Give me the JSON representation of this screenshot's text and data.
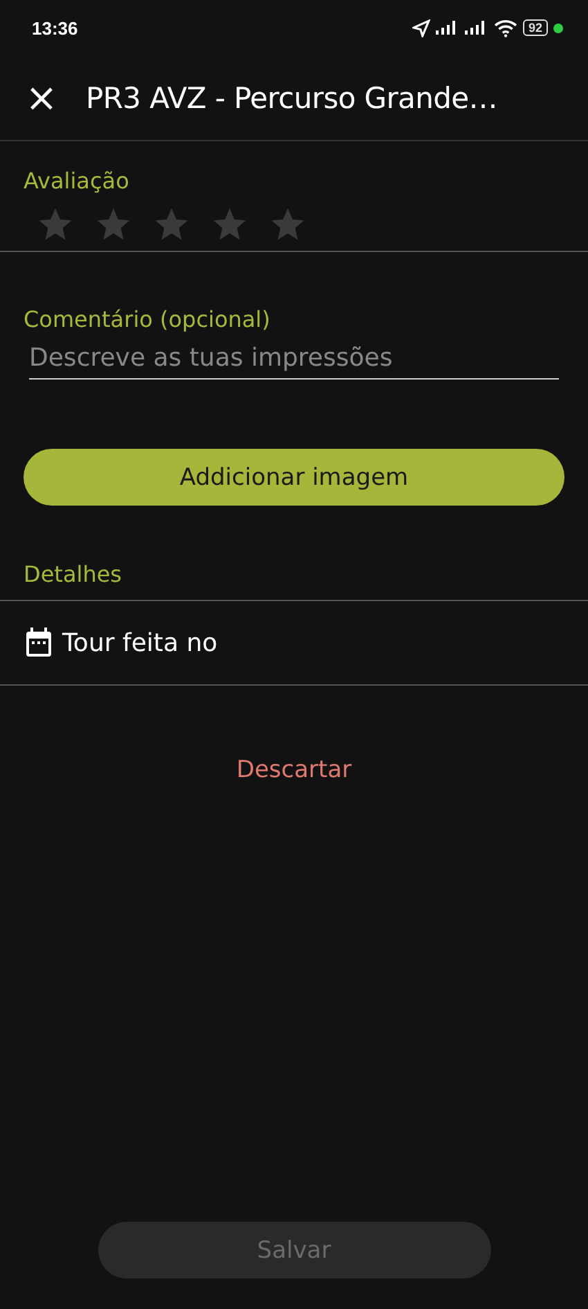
{
  "status_bar": {
    "time": "13:36",
    "battery": "92"
  },
  "header": {
    "close": "×",
    "title": "PR3 AVZ - Percurso Grande…"
  },
  "rating": {
    "label": "Avaliação",
    "stars": 0
  },
  "comment": {
    "label": "Comentário (opcional)",
    "placeholder": "Descreve as tuas impressões"
  },
  "add_image_button": "Addicionar imagem",
  "details": {
    "label": "Detalhes",
    "items": [
      {
        "kind": "date",
        "label": "Tour feita no"
      }
    ]
  },
  "discard_button": "Descartar",
  "save_button": {
    "label": "Salvar",
    "disabled": true
  }
}
